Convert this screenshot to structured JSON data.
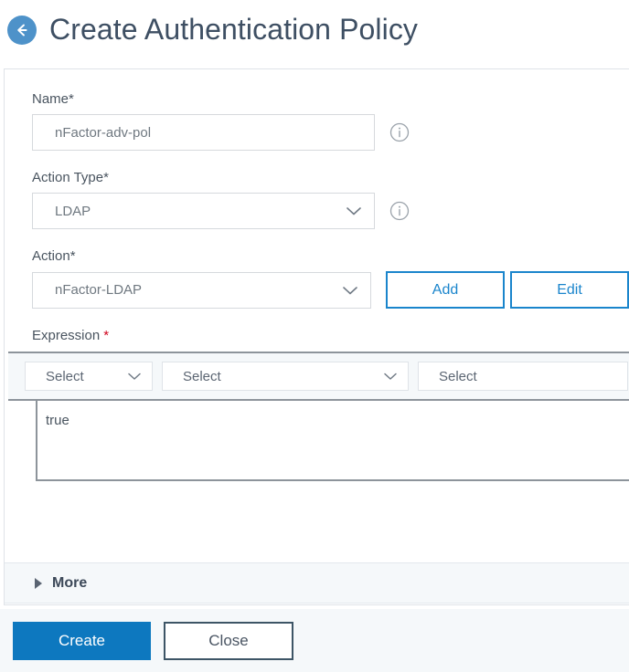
{
  "header": {
    "title": "Create Authentication Policy",
    "back_icon": "back-arrow-icon"
  },
  "form": {
    "name": {
      "label": "Name*",
      "value": "nFactor-adv-pol",
      "placeholder": "",
      "info_icon": "info-icon"
    },
    "action_type": {
      "label": "Action Type*",
      "value": "LDAP",
      "info_icon": "info-icon"
    },
    "action": {
      "label": "Action*",
      "value": "nFactor-LDAP",
      "add_label": "Add",
      "edit_label": "Edit"
    },
    "expression": {
      "label": "Expression",
      "required_mark": "*",
      "select_1": "Select",
      "select_2": "Select",
      "select_3": "Select",
      "value": "true"
    }
  },
  "more": {
    "label": "More"
  },
  "footer": {
    "create_label": "Create",
    "close_label": "Close"
  },
  "colors": {
    "primary_blue": "#0d78bf",
    "accent_blue": "#1a85cc",
    "back_circle": "#4e92c9",
    "title_text": "#3e4f63",
    "required_red": "#d0021b",
    "panel_bg": "#f5f8fa"
  }
}
